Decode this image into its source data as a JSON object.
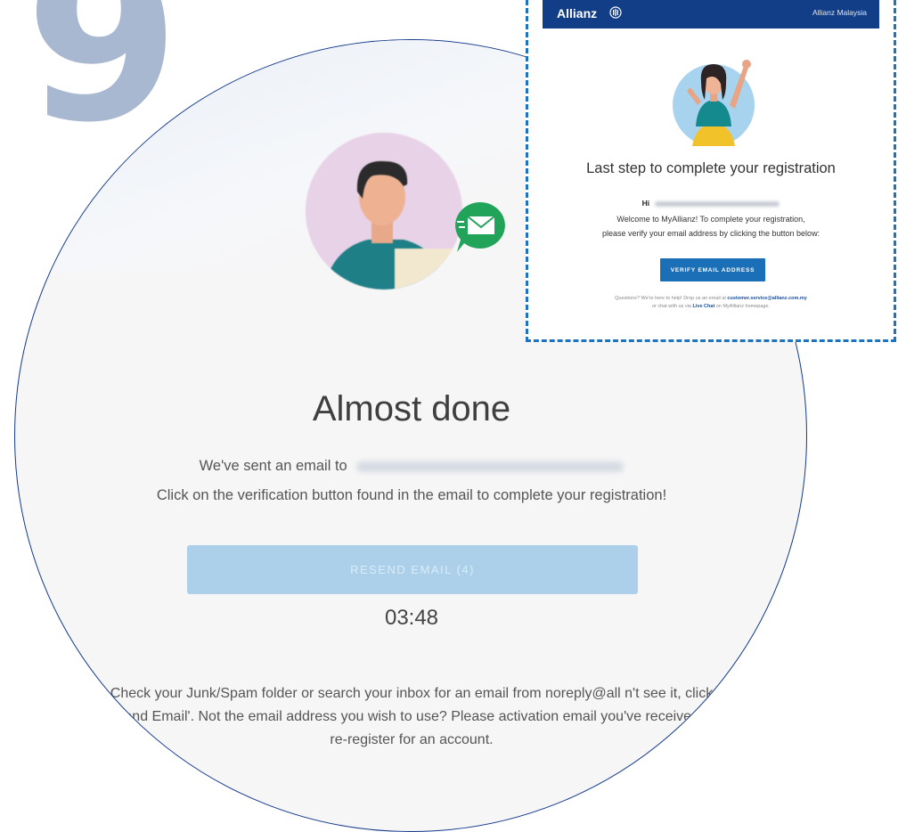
{
  "step_number": "9",
  "registration_page": {
    "title": "Almost done",
    "sent_text": "We've sent an email to",
    "instruction": "Click on the verification button found in the email to complete your registration!",
    "resend_label": "RESEND EMAIL (4)",
    "countdown": "03:48",
    "help_text": "Check your Junk/Spam folder or search your inbox for an email from noreply@all n't see it, click 'Resend Email'. Not the email address you wish to use? Please activation email you've received and re-register for an account."
  },
  "email": {
    "brand": "Allianz",
    "region": "Allianz Malaysia",
    "title": "Last step to complete your registration",
    "greeting": "Hi",
    "welcome_line1": "Welcome to MyAllianz! To complete your registration,",
    "welcome_line2": "please verify your email address by clicking the button below:",
    "verify_label": "VERIFY EMAIL ADDRESS",
    "footer_prefix": "Questions? We're here to help! Drop us an email at",
    "support_email": "customer.service@allianz.com.my",
    "footer_mid": "or chat with us via",
    "live_chat": "Live Chat",
    "footer_suffix": "on MyAllianz homepage."
  },
  "colors": {
    "brand_navy": "#123e87",
    "button_blue": "#1b6fb6",
    "resend_disabled": "#acd0ea",
    "numeral": "#a9b8d1",
    "callout_border": "#1e73be"
  },
  "icons": [
    "mail-bubble-icon",
    "allianz-logo-icon"
  ]
}
